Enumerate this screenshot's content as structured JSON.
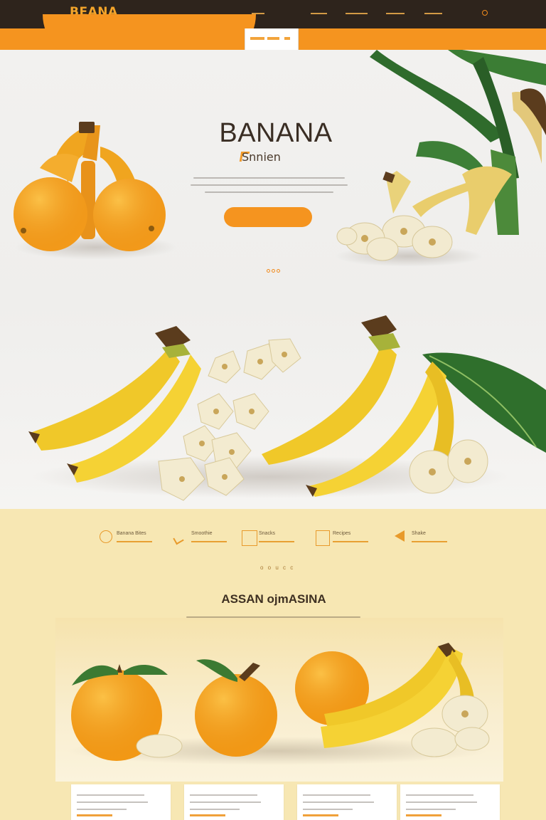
{
  "header": {
    "logo": "BEANA",
    "nav_items": [
      "",
      "",
      "",
      "",
      ""
    ],
    "colors": {
      "bar": "#2e241c",
      "accent": "#f5941f"
    }
  },
  "subnav": {
    "tab_label": ""
  },
  "hero": {
    "title": "BANANA",
    "subtitle": "Snnien",
    "cta_label": "",
    "slider_dots": 3
  },
  "features": [
    {
      "icon": "target-icon",
      "label": "Banana Bites"
    },
    {
      "icon": "banana-leaf-icon",
      "label": "Smoothie"
    },
    {
      "icon": "box-icon",
      "label": "Snacks"
    },
    {
      "icon": "document-icon",
      "label": "Recipes"
    },
    {
      "icon": "arrow-left-icon",
      "label": "Shake"
    }
  ],
  "section": {
    "title": "ASSAN ojmASINA",
    "pager": "o o u c c"
  },
  "cards": [
    {},
    {},
    {},
    {}
  ]
}
